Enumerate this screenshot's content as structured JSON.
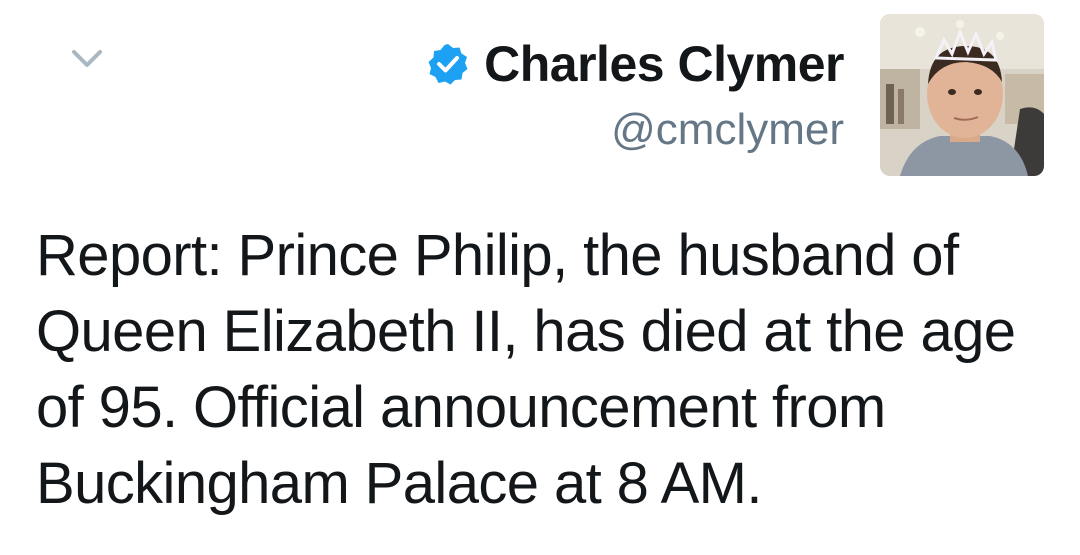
{
  "header": {
    "menu_icon": "chevron-down-icon",
    "verified_icon": "verified-badge-icon",
    "display_name": "Charles Clymer",
    "handle": "@cmclymer",
    "avatar_alt": "profile-photo"
  },
  "tweet": {
    "lines": [
      "Report: Prince Philip, the husband of",
      "Queen Elizabeth II, has died at the age",
      "of 95. Official announcement from",
      "Buckingham Palace at 8 AM."
    ]
  },
  "colors": {
    "verified_blue": "#1da1f2",
    "name": "#14171a",
    "handle": "#657786",
    "chevron": "#aab8c2"
  }
}
